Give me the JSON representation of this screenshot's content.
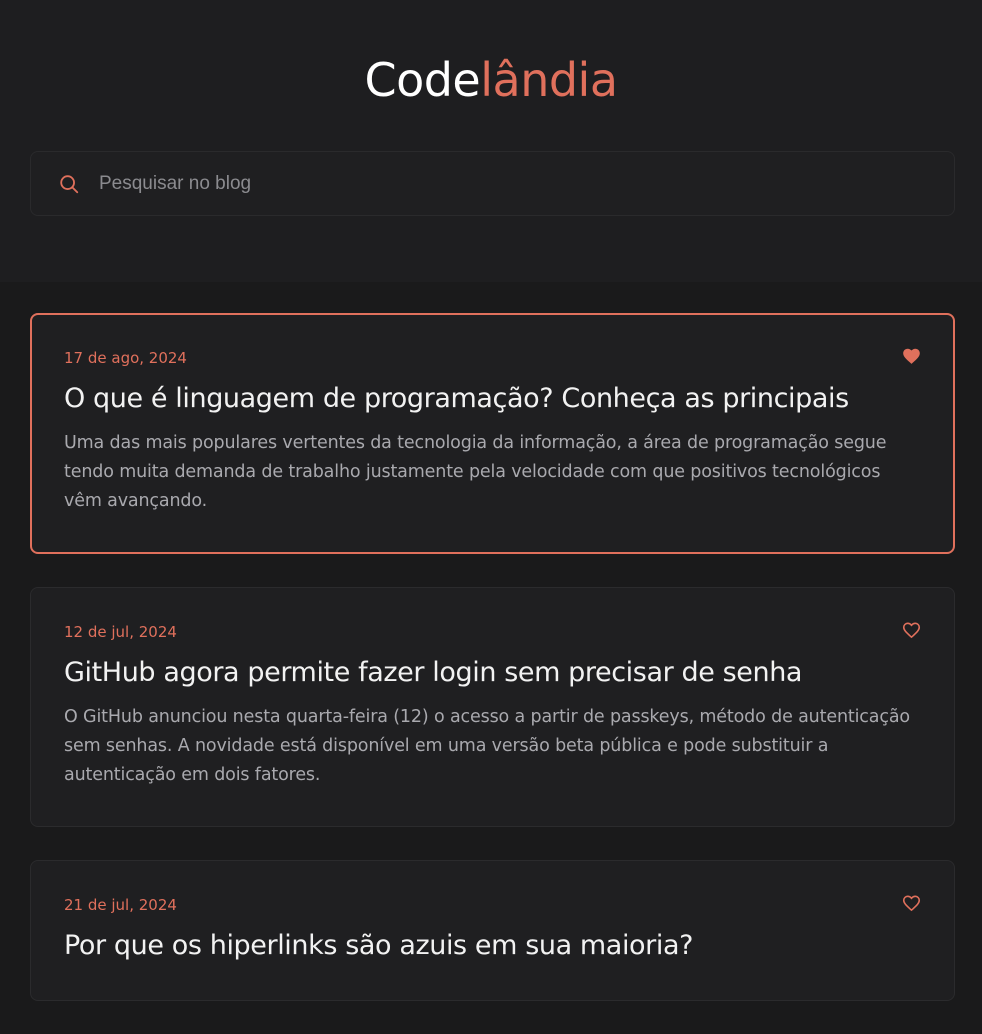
{
  "header": {
    "logo_part1": "Code",
    "logo_part2": "lândia"
  },
  "search": {
    "placeholder": "Pesquisar no blog",
    "value": ""
  },
  "posts": [
    {
      "date": "17 de ago, 2024",
      "title": "O que é linguagem de programação? Conheça as principais",
      "excerpt": "Uma das mais populares vertentes da tecnologia da informação, a área de programação segue tendo muita demanda de trabalho justamente pela velocidade com que positivos tecnológicos vêm avançando.",
      "liked": true
    },
    {
      "date": "12 de jul, 2024",
      "title": "GitHub agora permite fazer login sem precisar de senha",
      "excerpt": "O GitHub anunciou nesta quarta-feira (12) o acesso a partir de passkeys, método de autenticação sem senhas. A novidade está disponível em uma versão beta pública e pode substituir a autenticação em dois fatores.",
      "liked": false
    },
    {
      "date": "21 de jul, 2024",
      "title": "Por que os hiperlinks são azuis em sua maioria?",
      "excerpt": "",
      "liked": false
    }
  ],
  "colors": {
    "accent": "#e0705c",
    "background": "#1a1a1b",
    "card": "#1f1f21"
  }
}
